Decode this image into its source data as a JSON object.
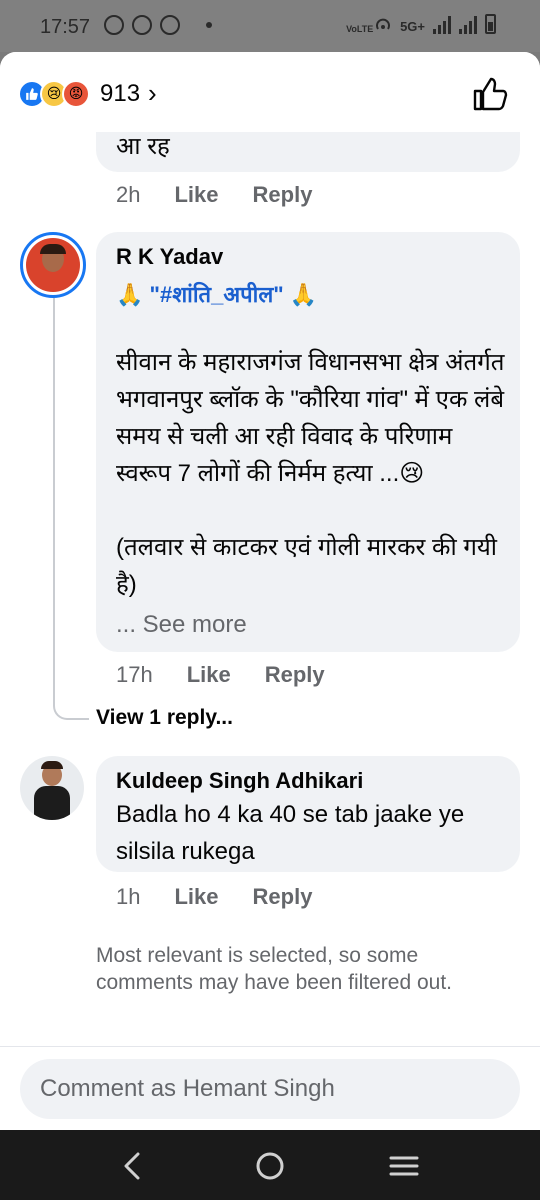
{
  "status_bar": {
    "time": "17:57",
    "network": "5G+",
    "carrier_mark": "VoLTE"
  },
  "header": {
    "reactions": [
      "like",
      "sad",
      "angry"
    ],
    "reaction_count": "913",
    "like_button_icon": "thumbs-up-icon"
  },
  "comments": [
    {
      "partial_text": "आ रह",
      "time": "2h",
      "like": "Like",
      "reply": "Reply"
    },
    {
      "author": "R K Yadav",
      "line1_emoji_left": "🙏",
      "hashtag": "\"#शांति_अपील\"",
      "line1_emoji_right": "🙏",
      "body": "सीवान के महाराजगंज विधानसभा क्षेत्र अंतर्गत भगवानपुर ब्लॉक के \"कौरिया गांव\" में एक लंबे समय से चली आ रही विवाद के परिणाम स्वरूप 7 लोगों की निर्मम हत्या ...😢",
      "body2": "(तलवार से काटकर एवं गोली मारकर की गयी है)",
      "see_more": "... See more",
      "time": "17h",
      "like": "Like",
      "reply": "Reply",
      "view_replies": "View 1 reply..."
    },
    {
      "author": "Kuldeep Singh Adhikari",
      "body": "Badla ho 4 ka 40 se tab jaake ye silsila rukega",
      "time": "1h",
      "like": "Like",
      "reply": "Reply"
    }
  ],
  "filter_note": "Most relevant is selected, so some comments may have been filtered out.",
  "composer": {
    "placeholder": "Comment as Hemant Singh"
  },
  "colors": {
    "accent": "#1877f2",
    "bubble": "#f0f2f5",
    "meta_text": "#65676b"
  }
}
